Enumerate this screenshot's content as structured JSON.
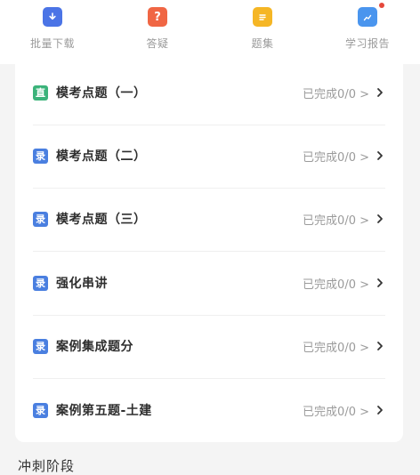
{
  "tabs": [
    {
      "label": "批量下载",
      "icon": "download-icon",
      "color": "#4b74e6"
    },
    {
      "label": "答疑",
      "icon": "question-icon",
      "color": "#f06644"
    },
    {
      "label": "题集",
      "icon": "document-icon",
      "color": "#f5b625"
    },
    {
      "label": "学习报告",
      "icon": "report-icon",
      "color": "#4a95ee",
      "has_dot": true
    }
  ],
  "rows": [
    {
      "badge": "直",
      "badge_color": "#3bb37a",
      "title": "模考点题（一）",
      "status": "已完成0/0 >"
    },
    {
      "badge": "录",
      "badge_color": "#4a7fe0",
      "title": "模考点题（二）",
      "status": "已完成0/0 >"
    },
    {
      "badge": "录",
      "badge_color": "#4a7fe0",
      "title": "模考点题（三）",
      "status": "已完成0/0 >"
    },
    {
      "badge": "录",
      "badge_color": "#4a7fe0",
      "title": "强化串讲",
      "status": "已完成0/0 >"
    },
    {
      "badge": "录",
      "badge_color": "#4a7fe0",
      "title": "案例集成题分",
      "status": "已完成0/0 >"
    },
    {
      "badge": "录",
      "badge_color": "#4a7fe0",
      "title": "案例第五题-土建",
      "status": "已完成0/0 >"
    }
  ],
  "next_section": {
    "title": "冲刺阶段"
  }
}
